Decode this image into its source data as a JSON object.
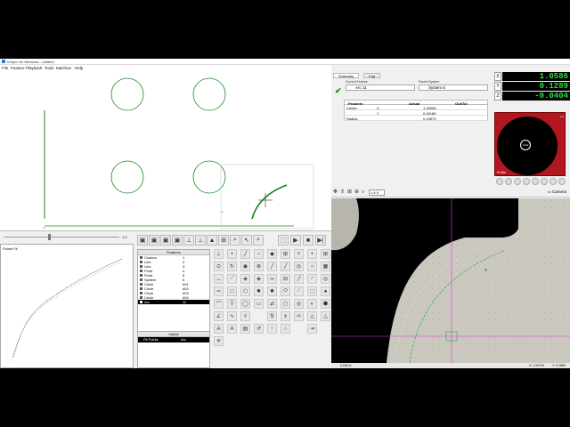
{
  "window": {
    "title": "InSpec for Windows - Untitled"
  },
  "menu": [
    "File",
    "Feature",
    "Playback",
    "Tools",
    "Machine",
    "Help"
  ],
  "slider": {
    "value": "1.0"
  },
  "points_fit": {
    "label": "Points Fit"
  },
  "features": {
    "header": "Features",
    "rows": [
      {
        "name": "Custom",
        "num": "1"
      },
      {
        "name": "Line",
        "num": "2"
      },
      {
        "name": "Line",
        "num": "3"
      },
      {
        "name": "Point",
        "num": "4"
      },
      {
        "name": "Point",
        "num": "5"
      },
      {
        "name": "System",
        "num": "6"
      },
      {
        "name": "Circle",
        "num": "#01"
      },
      {
        "name": "Circle",
        "num": "#02"
      },
      {
        "name": "Circle",
        "num": "#03"
      },
      {
        "name": "Circle",
        "num": "#04"
      },
      {
        "name": "Arc",
        "num": "11"
      }
    ],
    "selected_index": 10
  },
  "inputs": {
    "header": "Inputs",
    "name": "Fit Points",
    "value": "Arc"
  },
  "summary": {
    "tabs": [
      "Summary",
      "Log"
    ],
    "current_feature_label": "Current Feature:",
    "current_feature": "Arc 11",
    "parent_system_label": "Parent System:",
    "parent_system": "System 6",
    "columns": [
      "Property",
      "Actual",
      "Out/Tol"
    ],
    "rows": [
      {
        "property": "Center",
        "axis": "X",
        "actual": "1.18096"
      },
      {
        "property": "",
        "axis": "Y",
        "actual": "0.00189"
      },
      {
        "property": "Radius",
        "axis": "",
        "actual": "0.19573"
      }
    ]
  },
  "dro": [
    {
      "axis": "X",
      "value": "1.0586"
    },
    {
      "axis": "Y",
      "value": "0.1289"
    },
    {
      "axis": "Z",
      "value": "-0.0404"
    }
  ],
  "profile": {
    "label": "Profile",
    "center": "Axial",
    "side": "1.0"
  },
  "camera": {
    "zoom": "1.4 X",
    "button": "Camera"
  },
  "status": {
    "left": "0.025 in",
    "right1": "X: 1.04790",
    "right2": "Y: 0.1850"
  },
  "colors": {
    "dro_text": "#22e03a",
    "profile_red": "#b0171f",
    "cad_line": "#1a8a1a",
    "marker": "#d93ad9"
  }
}
